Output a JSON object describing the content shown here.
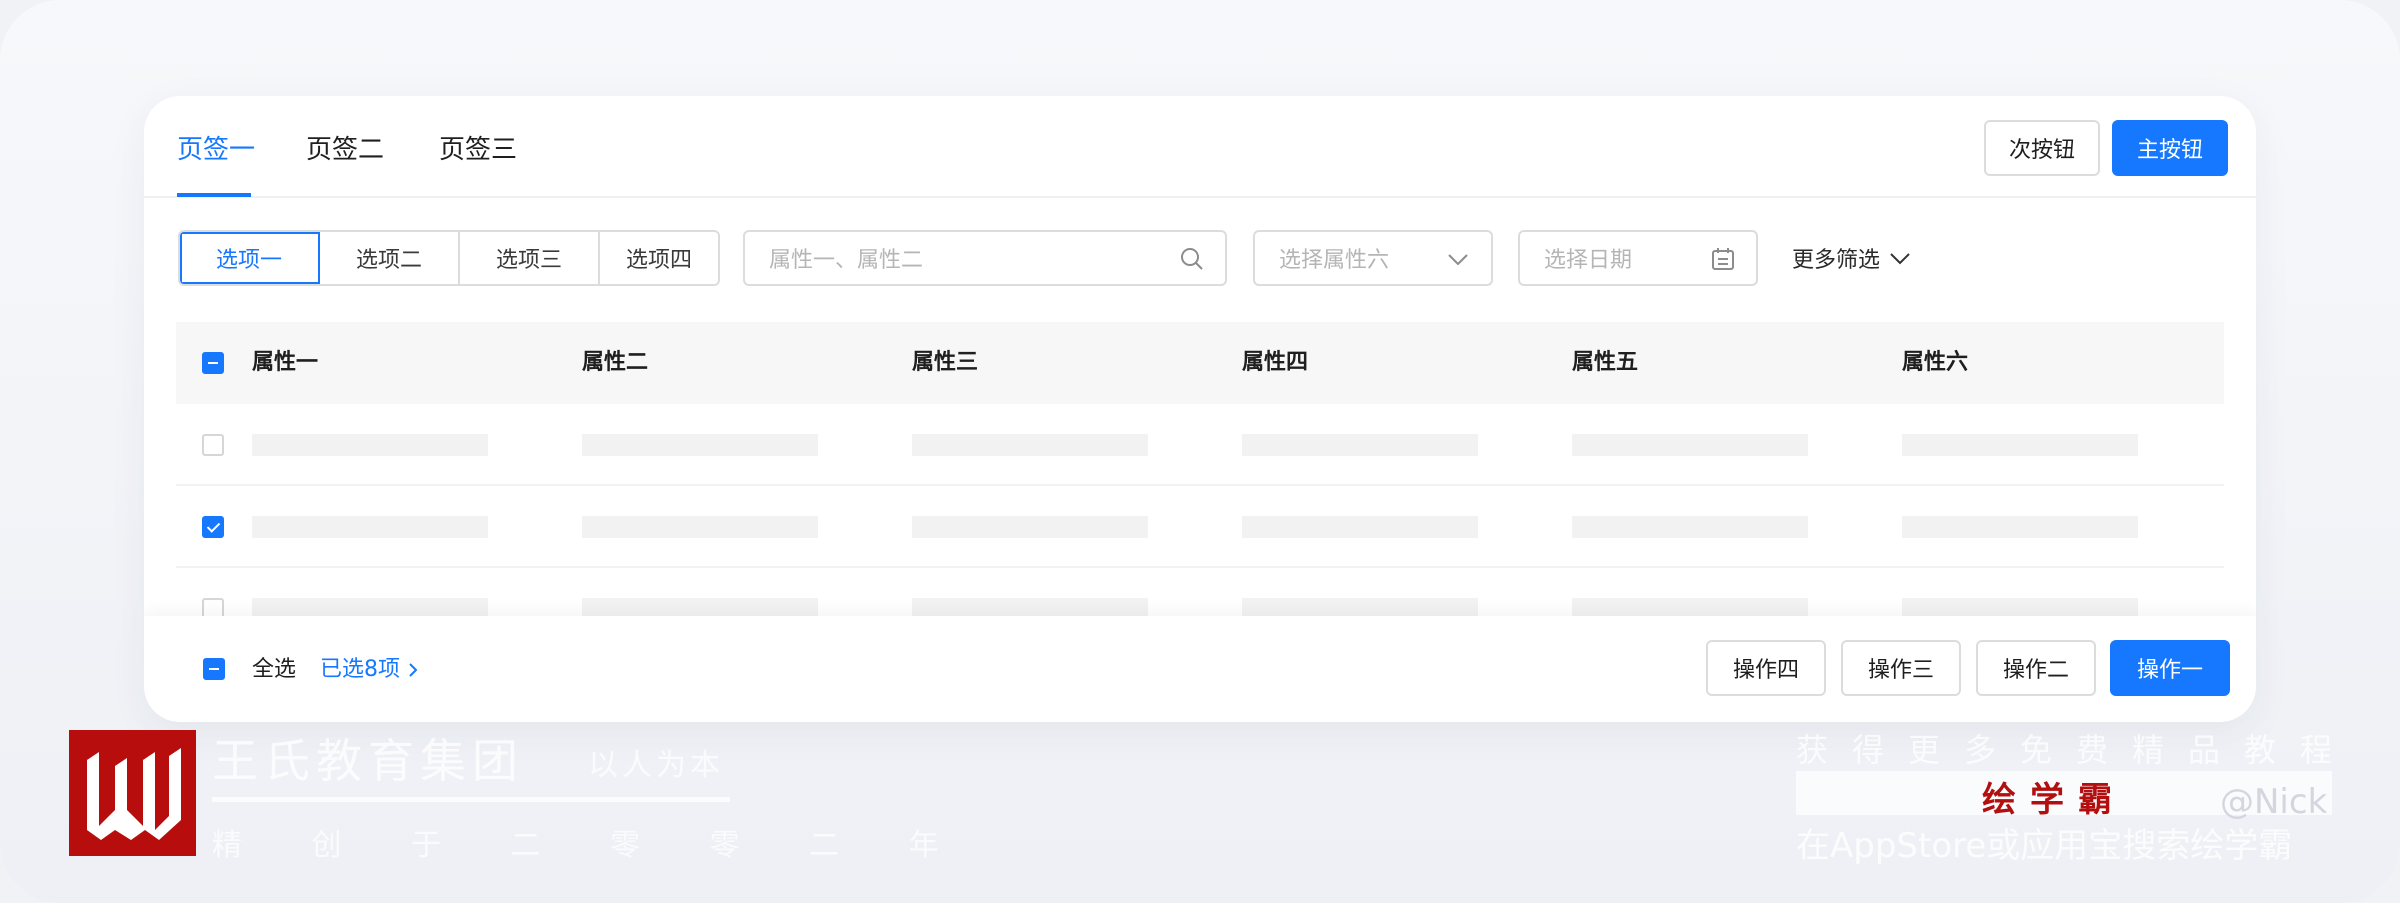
{
  "tabs": [
    {
      "label": "页签一",
      "active": true
    },
    {
      "label": "页签二",
      "active": false
    },
    {
      "label": "页签三",
      "active": false
    }
  ],
  "header_buttons": {
    "secondary": "次按钮",
    "primary": "主按钮"
  },
  "segmented": [
    "选项一",
    "选项二",
    "选项三",
    "选项四"
  ],
  "filters": {
    "search_placeholder": "属性一、属性二",
    "select_placeholder": "选择属性六",
    "date_placeholder": "选择日期",
    "more_label": "更多筛选"
  },
  "table": {
    "columns": [
      "属性一",
      "属性二",
      "属性三",
      "属性四",
      "属性五",
      "属性六"
    ],
    "rows": [
      {
        "checked": false
      },
      {
        "checked": true
      },
      {
        "checked": false
      }
    ]
  },
  "footer": {
    "select_all": "全选",
    "selected_count": "已选8项",
    "actions": [
      "操作四",
      "操作三",
      "操作二",
      "操作一"
    ]
  },
  "watermark": {
    "company": "王氏教育集团",
    "slogan": "以人为本",
    "tagline": "精 创 于 二 零 零 二 年",
    "promo": "获得更多免费精品教程",
    "brand": "绘学霸",
    "store": "在AppStore或应用宝搜索绘学霸",
    "handle": "@Nick"
  },
  "colors": {
    "accent": "#1677ff",
    "brand_red": "#b80d0d"
  }
}
